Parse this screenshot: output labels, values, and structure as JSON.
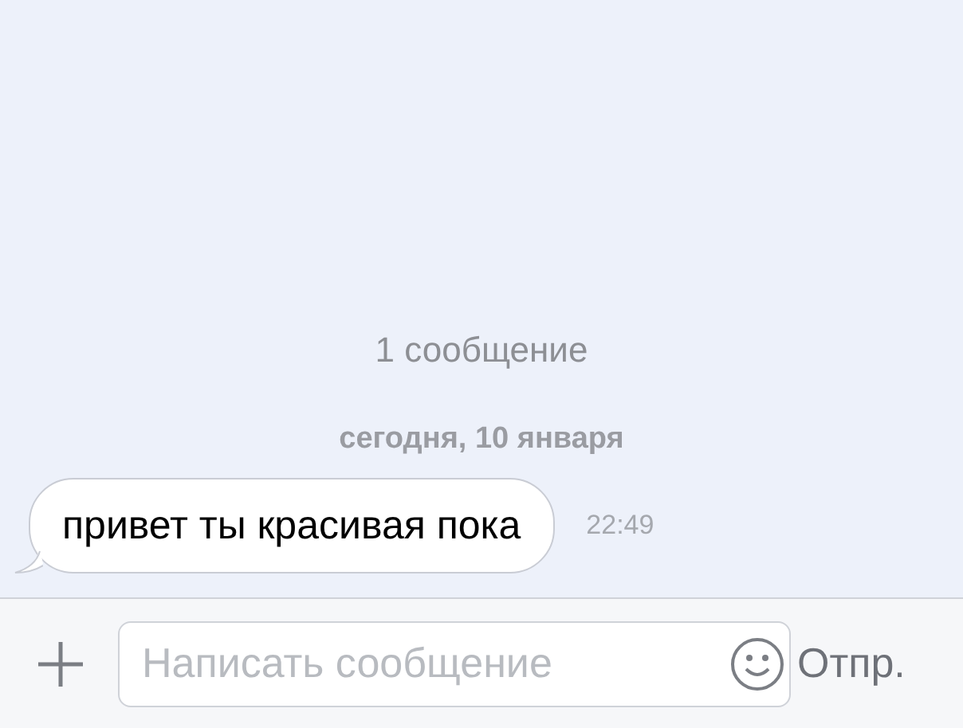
{
  "conversation": {
    "count": "1 сообщение",
    "date": "сегодня, 10 января"
  },
  "messages": [
    {
      "text": "привет ты красивая пока",
      "time": "22:49"
    }
  ],
  "composer": {
    "placeholder": "Написать сообщение",
    "send": "Отпр."
  }
}
